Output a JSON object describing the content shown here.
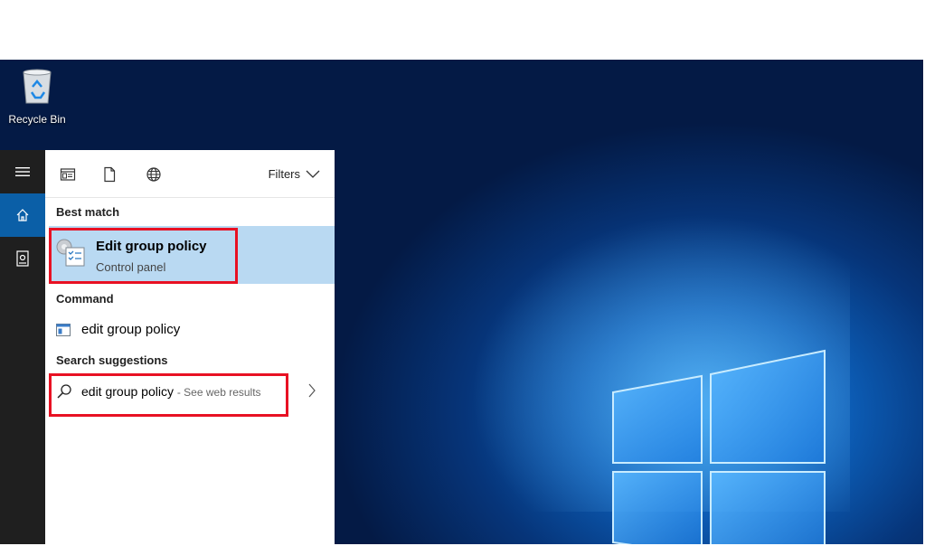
{
  "desktop": {
    "recycle_bin_label": "Recycle Bin"
  },
  "search": {
    "filters_label": "Filters",
    "best_match_header": "Best match",
    "best_match": {
      "title": "Edit group policy",
      "subtitle": "Control panel"
    },
    "command_header": "Command",
    "command_item": "edit group policy",
    "suggestions_header": "Search suggestions",
    "suggestion": {
      "text": "edit group policy",
      "suffix": "- See web results"
    }
  },
  "colors": {
    "highlight_border": "#e81123",
    "best_match_bg": "#b9d9f2",
    "rail_bg": "#1f1f1f",
    "rail_active": "#0b5fa7"
  }
}
